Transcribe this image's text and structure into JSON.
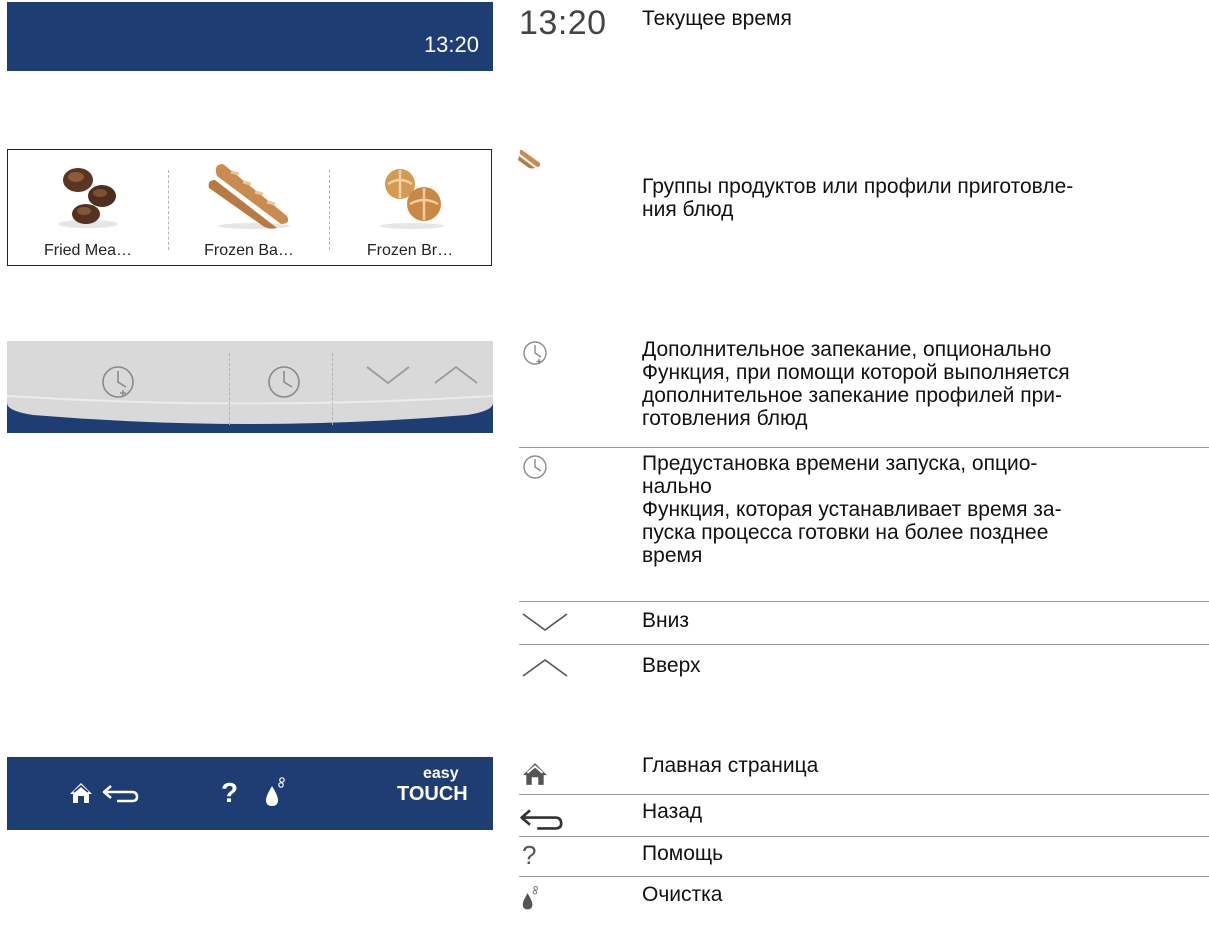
{
  "clock": {
    "time": "13:20"
  },
  "products": [
    {
      "label": "Fried Mea…",
      "icon": "fried-meatballs-image"
    },
    {
      "label": "Frozen Ba…",
      "icon": "frozen-baguette-image"
    },
    {
      "label": "Frozen Br…",
      "icon": "frozen-bread-rolls-image"
    }
  ],
  "cookbar": {
    "icons": [
      "post-baking-clock-icon",
      "start-time-preset-clock-icon",
      "chevron-down-icon",
      "chevron-up-icon"
    ]
  },
  "navbar": {
    "icons": [
      "home-icon",
      "back-arrow-icon",
      "help-icon",
      "cleaning-drop-icon"
    ],
    "help_glyph": "?",
    "logo_top": "easy",
    "logo_bottom": "TOUCH"
  },
  "legend": {
    "time": {
      "symbol": "13:20",
      "text": "Текущее время"
    },
    "groups": {
      "text": "Группы продуктов или профили приготовле-\nния блюд"
    },
    "post_baking": {
      "text": "Дополнительное запекание, опционально\nФункция, при помощи которой выполняется\nдополнительное запекание профилей при-\nготовления блюд"
    },
    "start_preset": {
      "text": "Предустановка времени запуска, опцио-\nнально\nФункция, которая устанавливает время за-\nпуска процесса готовки на более позднее\nвремя"
    },
    "down": {
      "text": "Вниз"
    },
    "up": {
      "text": "Вверх"
    },
    "home": {
      "text": "Главная страница"
    },
    "back": {
      "text": "Назад"
    },
    "help": {
      "symbol": "?",
      "text": "Помощь"
    },
    "clean": {
      "text": "Очистка"
    }
  },
  "colors": {
    "bar_blue": "#1e3d73",
    "panel_grey": "#d7d7d7",
    "icon_grey": "#8a8a8a"
  }
}
